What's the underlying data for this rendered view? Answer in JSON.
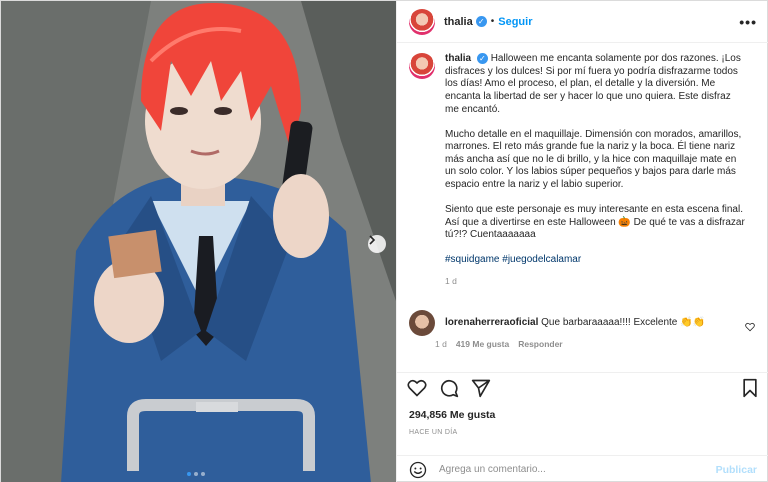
{
  "post": {
    "username": "thalia",
    "verified_glyph": "✓",
    "separator": "•",
    "follow_label": "Seguir",
    "more_label": "•••"
  },
  "caption": {
    "username": "thalia",
    "p1": "Halloween me encanta solamente por dos razones. ¡Los disfraces y los dulces! Si por mí fuera yo podría disfrazarme todos los días! Amo el proceso, el plan, el detalle y la diversión. Me encanta la libertad de ser y hacer lo que uno quiera. Este disfraz me encantó.",
    "p2": "Mucho detalle en el maquillaje. Dimensión con morados, amarillos, marrones. El reto más grande fue la nariz y la boca. Él tiene nariz más ancha así que no le di brillo, y la hice con maquillaje mate en un solo color. Y los labios súper pequeños y bajos para darle más espacio entre la nariz y el labio superior.",
    "p3": "Siento que este personaje es muy interesante en esta escena final. Así que a divertirse en este Halloween 🎃 De qué te vas a disfrazar tú?!? Cuentaaaaaaa",
    "hashtags": "#squidgame #juegodelcalamar",
    "time": "1 d"
  },
  "reply": {
    "username": "lorenaherreraoficial",
    "text": "Que barbaraaaaa!!!! Excelente 👏👏",
    "time": "1 d",
    "likes": "419 Me gusta",
    "reply_label": "Responder"
  },
  "stats": {
    "likes": "294,856 Me gusta",
    "ago": "HACE UN DÍA"
  },
  "add_comment": {
    "placeholder": "Agrega un comentario...",
    "publish_label": "Publicar"
  },
  "carousel": {
    "slide_count": 3,
    "active_index": 0
  },
  "colors": {
    "accent": "#0095f6",
    "verified": "#3897f0",
    "publish_disabled": "#b2dffc",
    "text": "#262626",
    "muted": "#8e8e8e"
  },
  "icons": [
    "heart-icon",
    "comment-icon",
    "share-icon",
    "bookmark-icon",
    "emoji-icon",
    "chevron-right-icon",
    "more-icon"
  ]
}
